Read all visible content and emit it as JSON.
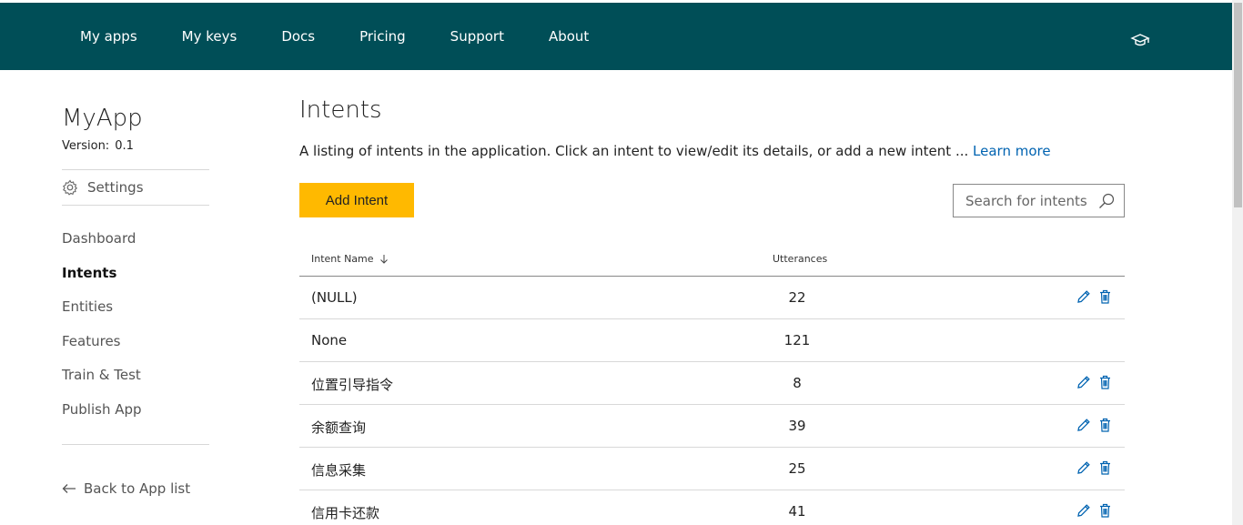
{
  "topnav": {
    "items": [
      "My apps",
      "My keys",
      "Docs",
      "Pricing",
      "Support",
      "About"
    ],
    "icon": "graduation-cap-icon"
  },
  "sidebar": {
    "app_name": "MyApp",
    "version_label": "Version:",
    "version_value": "0.1",
    "settings_label": "Settings",
    "nav_items": [
      "Dashboard",
      "Intents",
      "Entities",
      "Features",
      "Train & Test",
      "Publish App"
    ],
    "active_item": "Intents",
    "back_label": "Back to App list"
  },
  "main": {
    "title": "Intents",
    "description": "A listing of intents in the application. Click an intent to view/edit its details, or add a new intent ...",
    "learn_more": "Learn more",
    "add_button": "Add Intent",
    "search_placeholder": "Search for intents"
  },
  "table": {
    "columns": [
      "Intent Name",
      "Utterances"
    ],
    "rows": [
      {
        "name": "(NULL)",
        "utterances": "22",
        "actions": true
      },
      {
        "name": "None",
        "utterances": "121",
        "actions": false
      },
      {
        "name": "位置引导指令",
        "utterances": "8",
        "actions": true
      },
      {
        "name": "余额查询",
        "utterances": "39",
        "actions": true
      },
      {
        "name": "信息采集",
        "utterances": "25",
        "actions": true
      },
      {
        "name": "信用卡还款",
        "utterances": "41",
        "actions": true
      }
    ]
  },
  "colors": {
    "topbar": "#004e57",
    "accent_button": "#ffb900",
    "link": "#0063b1",
    "action_icons": "#0063b1"
  }
}
